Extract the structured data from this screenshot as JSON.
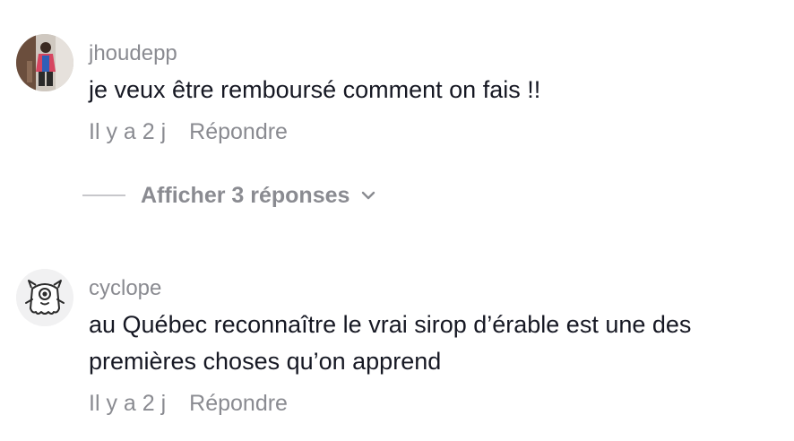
{
  "comments": [
    {
      "username": "jhoudepp",
      "text": "je veux être remboursé comment on fais !!",
      "time": "Il y a 2 j",
      "reply_label": "Répondre",
      "avatar_icon": "user-photo-avatar",
      "view_replies_label": "Afficher 3 réponses"
    },
    {
      "username": "cyclope",
      "text": "au Québec reconnaître le vrai sirop d’érable est une des premières choses qu’on apprend",
      "time": "Il y a 2 j",
      "reply_label": "Répondre",
      "avatar_icon": "cyclops-monster-avatar"
    }
  ],
  "colors": {
    "text": "#161823",
    "secondary": "#8a8b91",
    "divider": "#c7c7cb"
  }
}
